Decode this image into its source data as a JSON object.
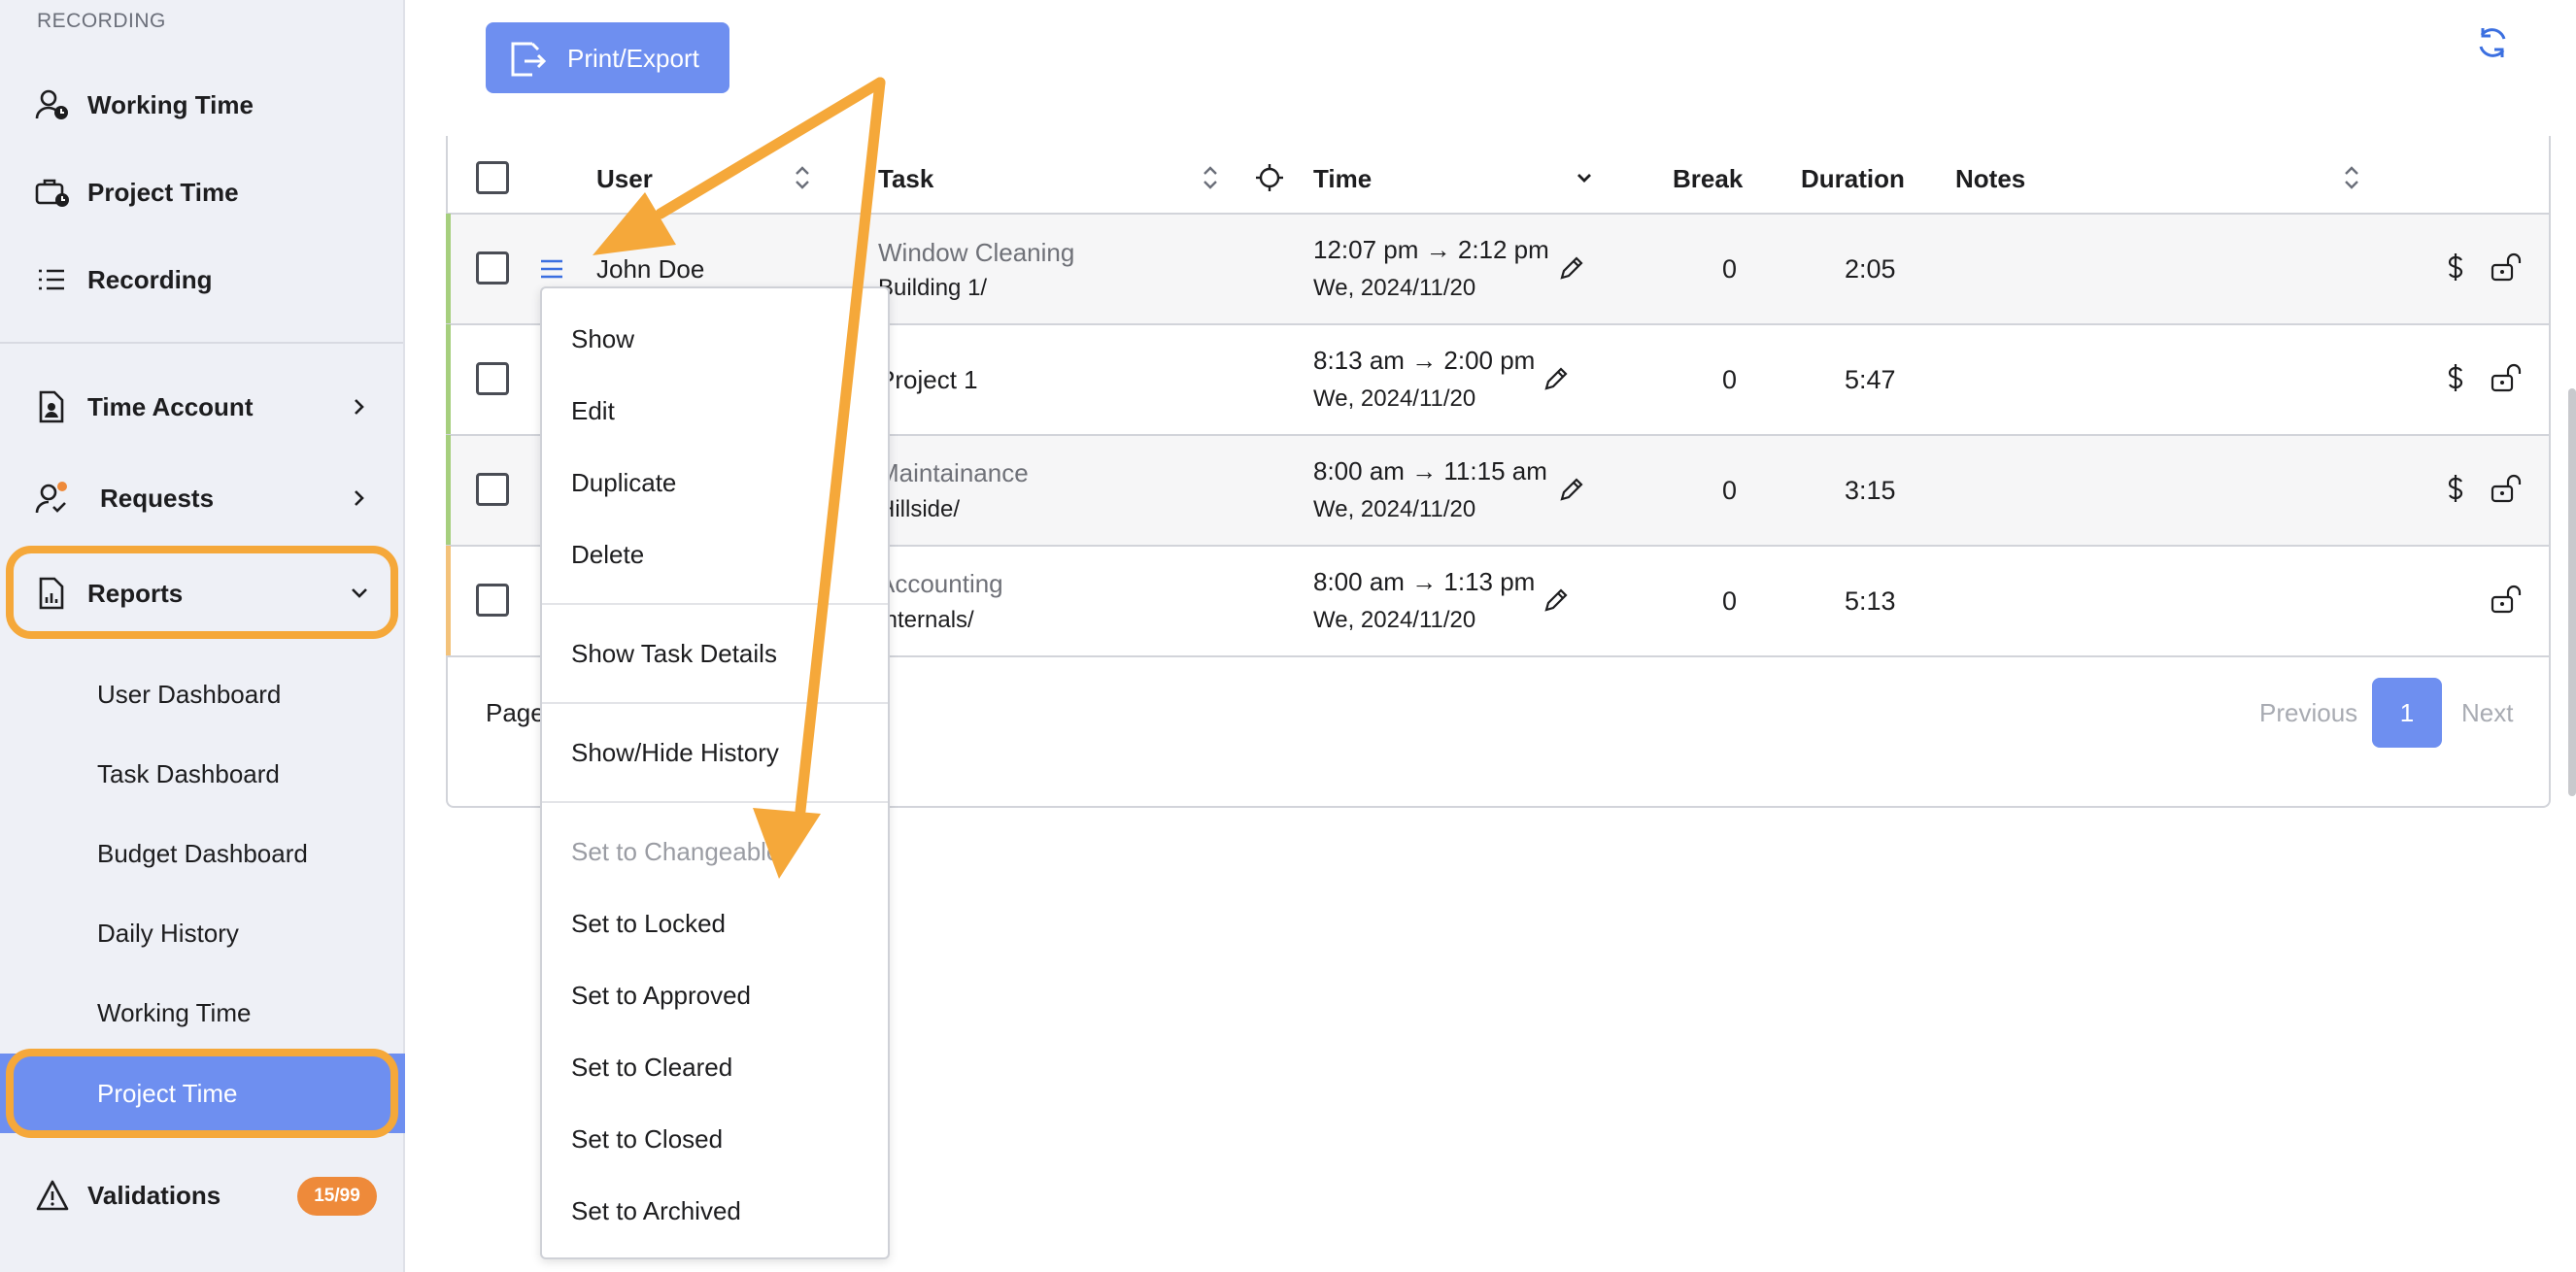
{
  "sidebar": {
    "section_label": "RECORDING",
    "items": [
      {
        "label": "Working Time",
        "icon": "user-clock-icon"
      },
      {
        "label": "Project Time",
        "icon": "briefcase-clock-icon"
      },
      {
        "label": "Recording",
        "icon": "list-icon"
      },
      {
        "label": "Time Account",
        "icon": "file-user-icon"
      },
      {
        "label": "Requests",
        "icon": "user-check-icon"
      },
      {
        "label": "Reports",
        "icon": "report-icon"
      }
    ],
    "report_items": [
      "User Dashboard",
      "Task Dashboard",
      "Budget Dashboard",
      "Daily History",
      "Working Time",
      "Project Time"
    ],
    "validations": {
      "label": "Validations",
      "badge": "15/99",
      "icon": "warning-icon"
    }
  },
  "toolbar": {
    "print_label": "Print/Export"
  },
  "table": {
    "headers": {
      "user": "User",
      "task": "Task",
      "time": "Time",
      "break": "Break",
      "duration": "Duration",
      "notes": "Notes"
    },
    "rows": [
      {
        "user": "John Doe",
        "task": "Window Cleaning",
        "task_path": "Building 1/",
        "time": "12:07 pm → 2:12 pm",
        "date": "We, 2024/11/20",
        "break": "0",
        "duration": "2:05",
        "status_color": "#a6cf7e"
      },
      {
        "user": "",
        "task": "Project 1",
        "task_path": "",
        "time": "8:13 am → 2:00 pm",
        "date": "We, 2024/11/20",
        "break": "0",
        "duration": "5:47",
        "status_color": "#a6cf7e"
      },
      {
        "user": "",
        "task": "Maintainance",
        "task_path": "Hillside/",
        "time": "8:00 am → 11:15 am",
        "date": "We, 2024/11/20",
        "break": "0",
        "duration": "3:15",
        "status_color": "#a6cf7e"
      },
      {
        "user": "",
        "task": "Accounting",
        "task_path": "Internals/",
        "time": "8:00 am → 1:13 pm",
        "date": "We, 2024/11/20",
        "break": "0",
        "duration": "5:13",
        "status_color": "#f3c27a"
      }
    ]
  },
  "pagination": {
    "page_label": "Page",
    "previous": "Previous",
    "current": "1",
    "next": "Next"
  },
  "context_menu": {
    "group1": [
      "Show",
      "Edit",
      "Duplicate",
      "Delete"
    ],
    "task_details": "Show Task Details",
    "history": "Show/Hide History",
    "status_items": [
      "Set to Changeable",
      "Set to Locked",
      "Set to Approved",
      "Set to Cleared",
      "Set to Closed",
      "Set to Archived"
    ]
  },
  "colors": {
    "accent": "#6e8ff0",
    "highlight": "#f5a83a",
    "badge": "#ee8a3a"
  }
}
